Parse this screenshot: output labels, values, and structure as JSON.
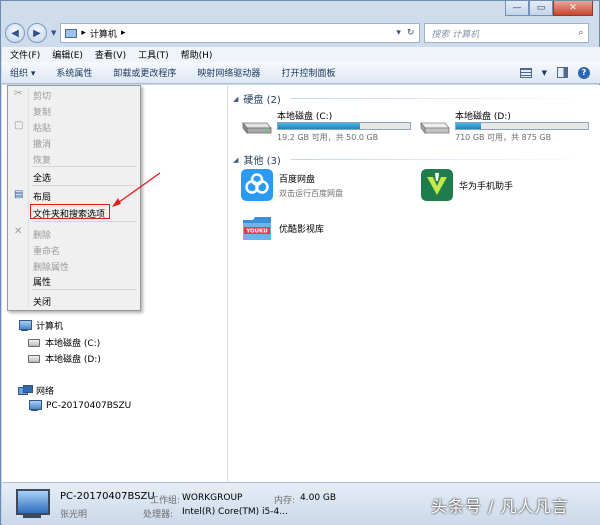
{
  "window": {
    "address_path": "计算机",
    "search_placeholder": "搜索 计算机"
  },
  "menubar": [
    "文件(F)",
    "编辑(E)",
    "查看(V)",
    "工具(T)",
    "帮助(H)"
  ],
  "toolbar": {
    "organize": "组织 ▾",
    "items": [
      "系统属性",
      "卸载或更改程序",
      "映射网络驱动器",
      "打开控制面板"
    ]
  },
  "organize_menu": {
    "cut": "剪切",
    "copy": "复制",
    "paste": "粘贴",
    "undo": "撤消",
    "redo": "恢复",
    "select_all": "全选",
    "layout": "布局",
    "folder_options": "文件夹和搜索选项",
    "delete": "删除",
    "rename": "重命名",
    "remove_props": "删除属性",
    "properties": "属性",
    "close": "关闭"
  },
  "nav_tree": {
    "computer": "计算机",
    "drive_c": "本地磁盘 (C:)",
    "drive_d": "本地磁盘 (D:)",
    "network": "网络",
    "pc_name": "PC-20170407BSZU"
  },
  "content": {
    "hard_disks_header": "硬盘 (2)",
    "other_header": "其他 (3)",
    "drives": [
      {
        "name": "本地磁盘 (C:)",
        "stat": "19.2 GB 可用，共 50.0 GB",
        "used_fraction": 0.62
      },
      {
        "name": "本地磁盘 (D:)",
        "stat": "710 GB 可用，共 875 GB",
        "used_fraction": 0.19
      }
    ],
    "apps": [
      {
        "name": "百度网盘",
        "sub": "双击运行百度网盘"
      },
      {
        "name": "华为手机助手",
        "sub": ""
      },
      {
        "name": "优酷影视库",
        "sub": ""
      }
    ]
  },
  "statusbar": {
    "name": "PC-20170407BSZU",
    "user": "张光明",
    "workgroup_label": "工作组:",
    "workgroup": "WORKGROUP",
    "memory_label": "内存:",
    "memory": "4.00 GB",
    "cpu_label": "处理器:",
    "cpu": "Intel(R) Core(TM) i5-4..."
  },
  "watermark": "头条号 / 凡人凡言",
  "colors": {
    "highlight_box": "#e21b1b",
    "annotation_arrow": "#e21b1b"
  }
}
